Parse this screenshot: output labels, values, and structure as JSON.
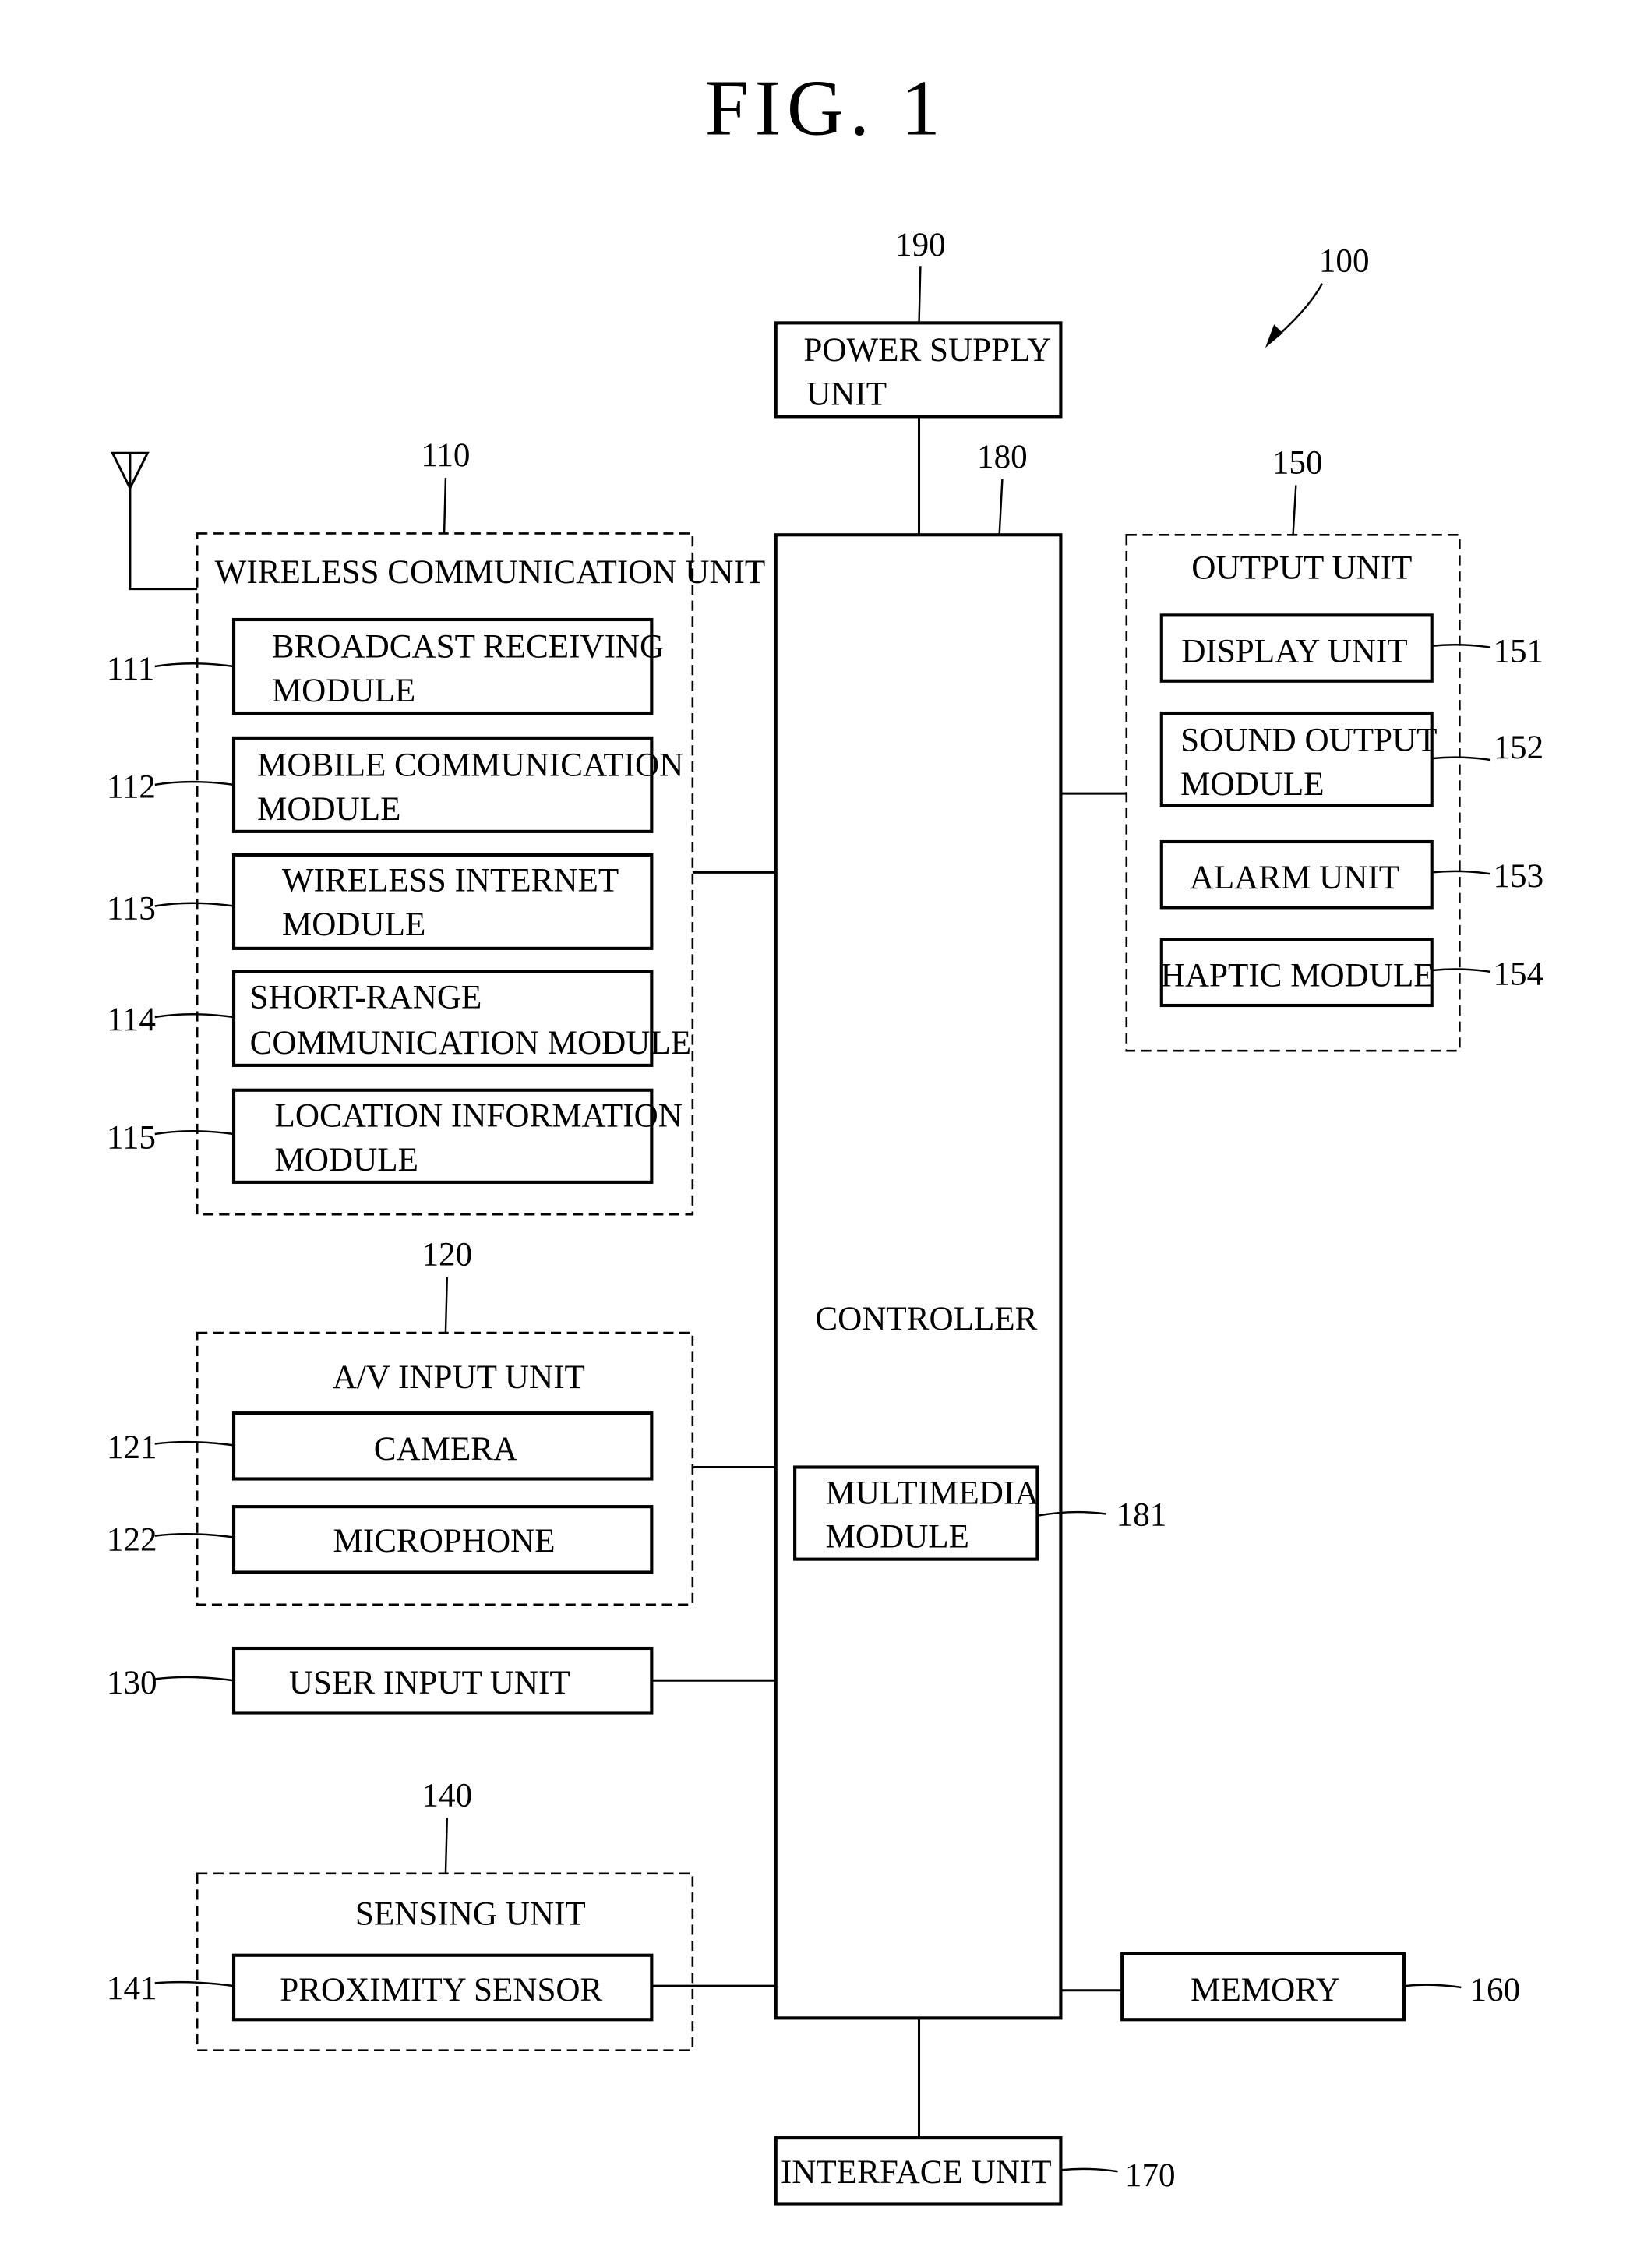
{
  "figure": {
    "title": "FIG. 1",
    "device_ref": "100"
  },
  "power_supply": {
    "ref": "190",
    "label_line1": "POWER SUPPLY",
    "label_line2": "UNIT"
  },
  "controller": {
    "ref": "180",
    "label": "CONTROLLER",
    "multimedia": {
      "ref": "181",
      "label_line1": "MULTIMEDIA",
      "label_line2": "MODULE"
    }
  },
  "wireless_unit": {
    "ref": "110",
    "label": "WIRELESS COMMUNICATION UNIT",
    "modules": [
      {
        "ref": "111",
        "line1": "BROADCAST RECEIVING",
        "line2": "MODULE"
      },
      {
        "ref": "112",
        "line1": "MOBILE COMMUNICATION",
        "line2": "MODULE"
      },
      {
        "ref": "113",
        "line1": "WIRELESS INTERNET",
        "line2": "MODULE"
      },
      {
        "ref": "114",
        "line1": "SHORT-RANGE",
        "line2": "COMMUNICATION MODULE"
      },
      {
        "ref": "115",
        "line1": "LOCATION INFORMATION",
        "line2": "MODULE"
      }
    ]
  },
  "av_input": {
    "ref": "120",
    "label": "A/V INPUT UNIT",
    "modules": [
      {
        "ref": "121",
        "label": "CAMERA"
      },
      {
        "ref": "122",
        "label": "MICROPHONE"
      }
    ]
  },
  "user_input": {
    "ref": "130",
    "label": "USER INPUT UNIT"
  },
  "sensing": {
    "ref": "140",
    "label": "SENSING UNIT",
    "modules": [
      {
        "ref": "141",
        "label": "PROXIMITY SENSOR"
      }
    ]
  },
  "output_unit": {
    "ref": "150",
    "label": "OUTPUT UNIT",
    "modules": [
      {
        "ref": "151",
        "line1": "DISPLAY UNIT",
        "line2": ""
      },
      {
        "ref": "152",
        "line1": "SOUND OUTPUT",
        "line2": "MODULE"
      },
      {
        "ref": "153",
        "line1": "ALARM UNIT",
        "line2": ""
      },
      {
        "ref": "154",
        "line1": "HAPTIC MODULE",
        "line2": ""
      }
    ]
  },
  "memory": {
    "ref": "160",
    "label": "MEMORY"
  },
  "interface": {
    "ref": "170",
    "label": "INTERFACE UNIT"
  }
}
